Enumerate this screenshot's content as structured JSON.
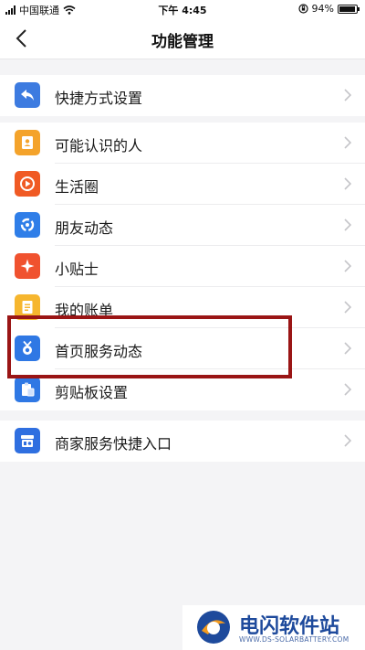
{
  "status_bar": {
    "carrier": "中国联通",
    "time": "下午 4:45",
    "battery": "94%",
    "battery_level": 0.94
  },
  "nav": {
    "title": "功能管理"
  },
  "groups": [
    [
      {
        "label": "快捷方式设置",
        "icon": "share-arrow-icon",
        "color": "#3d7be0"
      }
    ],
    [
      {
        "label": "可能认识的人",
        "icon": "contact-card-icon",
        "color": "#f4a32b"
      },
      {
        "label": "生活圈",
        "icon": "play-circle-icon",
        "color": "#f05a24"
      },
      {
        "label": "朋友动态",
        "icon": "refresh-ring-icon",
        "color": "#2f7ee8"
      },
      {
        "label": "小贴士",
        "icon": "sparkle-icon",
        "color": "#f0522f"
      },
      {
        "label": "我的账单",
        "icon": "bill-list-icon",
        "color": "#f6b62e"
      },
      {
        "label": "首页服务动态",
        "icon": "medal-icon",
        "color": "#2f78e4"
      },
      {
        "label": "剪贴板设置",
        "icon": "clipboard-icon",
        "color": "#2f78e4"
      }
    ],
    [
      {
        "label": "商家服务快捷入口",
        "icon": "store-icon",
        "color": "#2f6fe0"
      }
    ]
  ],
  "highlight_color": "#9a1515",
  "watermark": {
    "brand": "电闪软件站",
    "domain": "WWW.DS-SOLARBATTERY.COM"
  }
}
